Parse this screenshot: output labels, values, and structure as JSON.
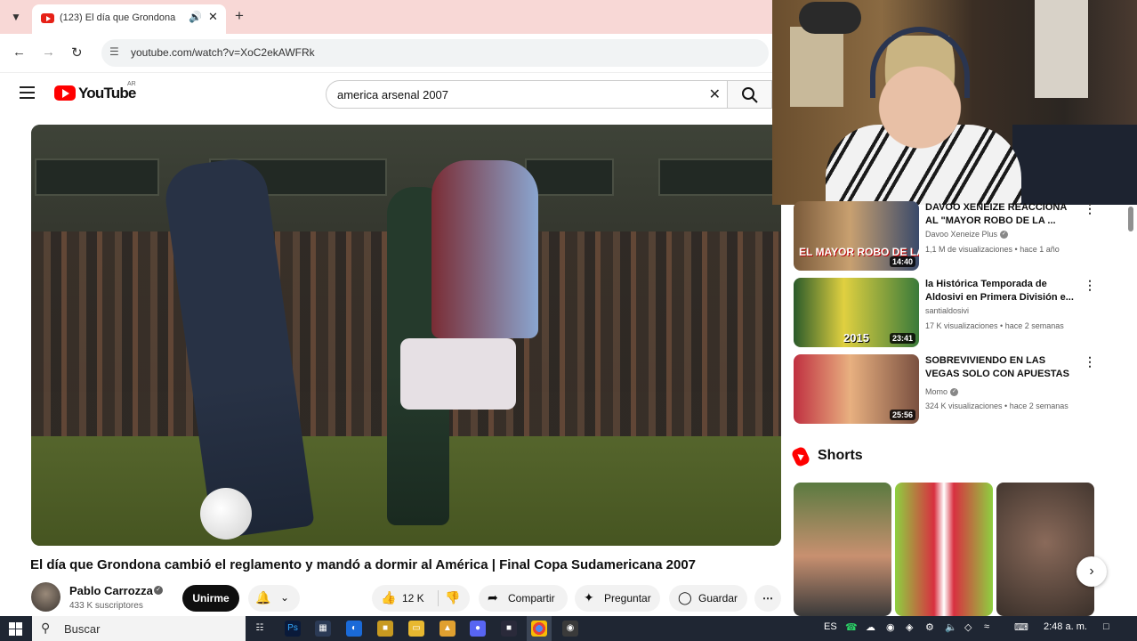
{
  "browser": {
    "tab_title": "(123) El día que Grondona",
    "url": "youtube.com/watch?v=XoC2ekAWFRk"
  },
  "youtube": {
    "wordmark": "YouTube",
    "country_code": "AR",
    "search_query": "america arsenal 2007"
  },
  "video": {
    "title": "El día que Grondona cambió el reglamento y mandó a dormir al América | Final Copa Sudamericana 2007",
    "channel": "Pablo Carrozza",
    "subscribers": "433 K suscriptores",
    "subscribe_label": "Unirme",
    "likes": "12 K",
    "share_label": "Compartir",
    "ask_label": "Preguntar",
    "save_label": "Guardar"
  },
  "recommendations": [
    {
      "title": "DAVOO XENEIZE REACCIONA AL \"MAYOR ROBO DE LA ...",
      "channel": "Davoo Xeneize Plus",
      "verified": true,
      "meta": "1,1 M de visualizaciones • hace 1 año",
      "duration": "14:40",
      "thumb_text": "EL MAYOR ROBO DE LA HISTO"
    },
    {
      "title": "la Histórica Temporada de Aldosivi en Primera División e...",
      "channel": "santialdosivi",
      "verified": false,
      "meta": "17 K visualizaciones • hace 2 semanas",
      "duration": "23:41",
      "thumb_text": "2015"
    },
    {
      "title": "SOBREVIVIENDO EN LAS VEGAS SOLO CON APUESTAS",
      "channel": "Momo",
      "verified": true,
      "meta": "324 K visualizaciones • hace 2 semanas",
      "duration": "25:56",
      "thumb_text": ""
    }
  ],
  "shorts": {
    "label": "Shorts"
  },
  "taskbar": {
    "search_placeholder": "Buscar",
    "language": "ES",
    "time": "2:48 a. m."
  },
  "icons": {
    "search": "search-icon",
    "audio": "speaker-icon",
    "like": "thumbs-up-icon",
    "dislike": "thumbs-down-icon",
    "share": "share-arrow-icon",
    "ask": "sparkle-icon",
    "save": "bookmark-icon",
    "bell": "bell-icon"
  },
  "colors": {
    "yt_red": "#ff0000",
    "tab_bar": "#f8d8d6",
    "taskbar": "#1f2633"
  }
}
